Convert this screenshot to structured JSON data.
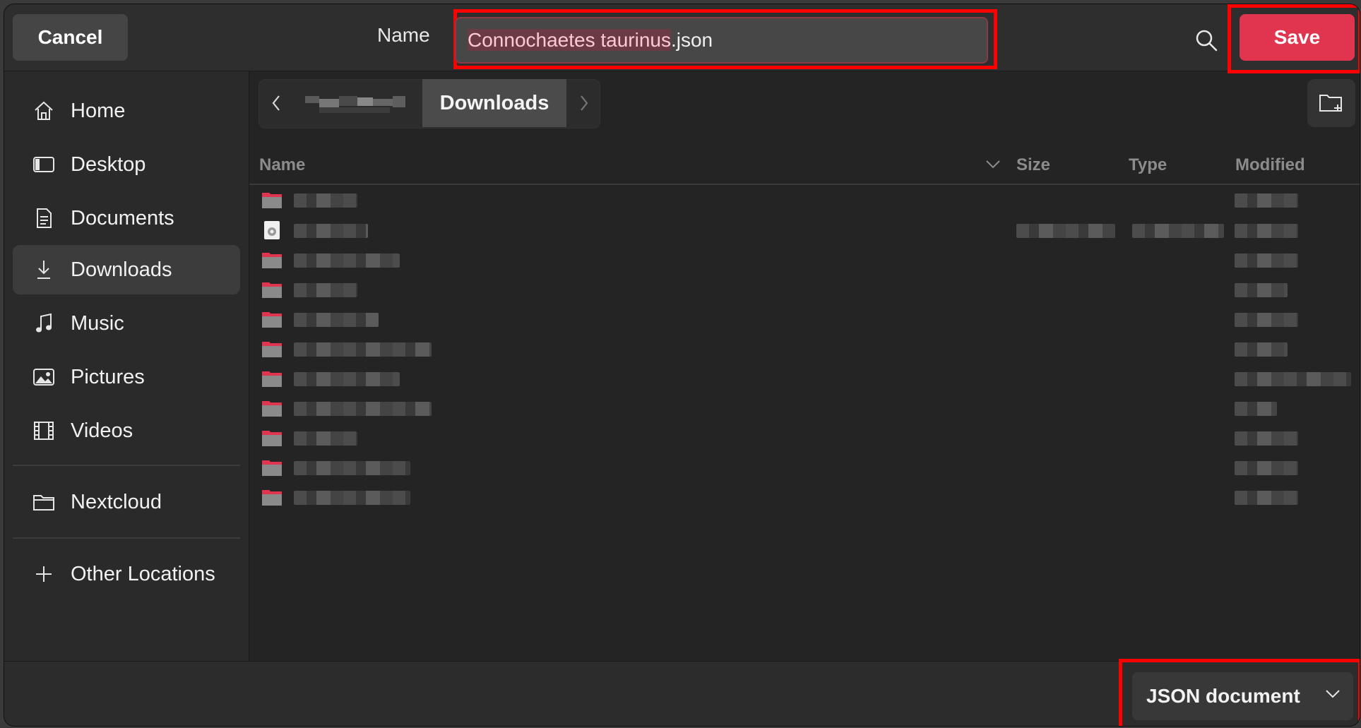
{
  "header": {
    "cancel_label": "Cancel",
    "name_label": "Name",
    "filename_stem": "Connochaetes taurinus",
    "filename_ext": ".json",
    "save_label": "Save"
  },
  "sidebar": {
    "items": [
      {
        "label": "Home",
        "icon": "home-icon"
      },
      {
        "label": "Desktop",
        "icon": "desktop-icon"
      },
      {
        "label": "Documents",
        "icon": "documents-icon"
      },
      {
        "label": "Downloads",
        "icon": "downloads-icon",
        "active": true
      },
      {
        "label": "Music",
        "icon": "music-icon"
      },
      {
        "label": "Pictures",
        "icon": "pictures-icon"
      },
      {
        "label": "Videos",
        "icon": "videos-icon"
      },
      {
        "label": "Nextcloud",
        "icon": "folder-icon"
      },
      {
        "label": "Other Locations",
        "icon": "plus-icon"
      }
    ]
  },
  "pathbar": {
    "current": "Downloads"
  },
  "columns": {
    "name": "Name",
    "size": "Size",
    "type": "Type",
    "modified": "Modified"
  },
  "footer": {
    "filter_label": "JSON document"
  },
  "colors": {
    "accent": "#e0344f",
    "highlight_border": "#ff0000",
    "folder": "#e0344f"
  }
}
